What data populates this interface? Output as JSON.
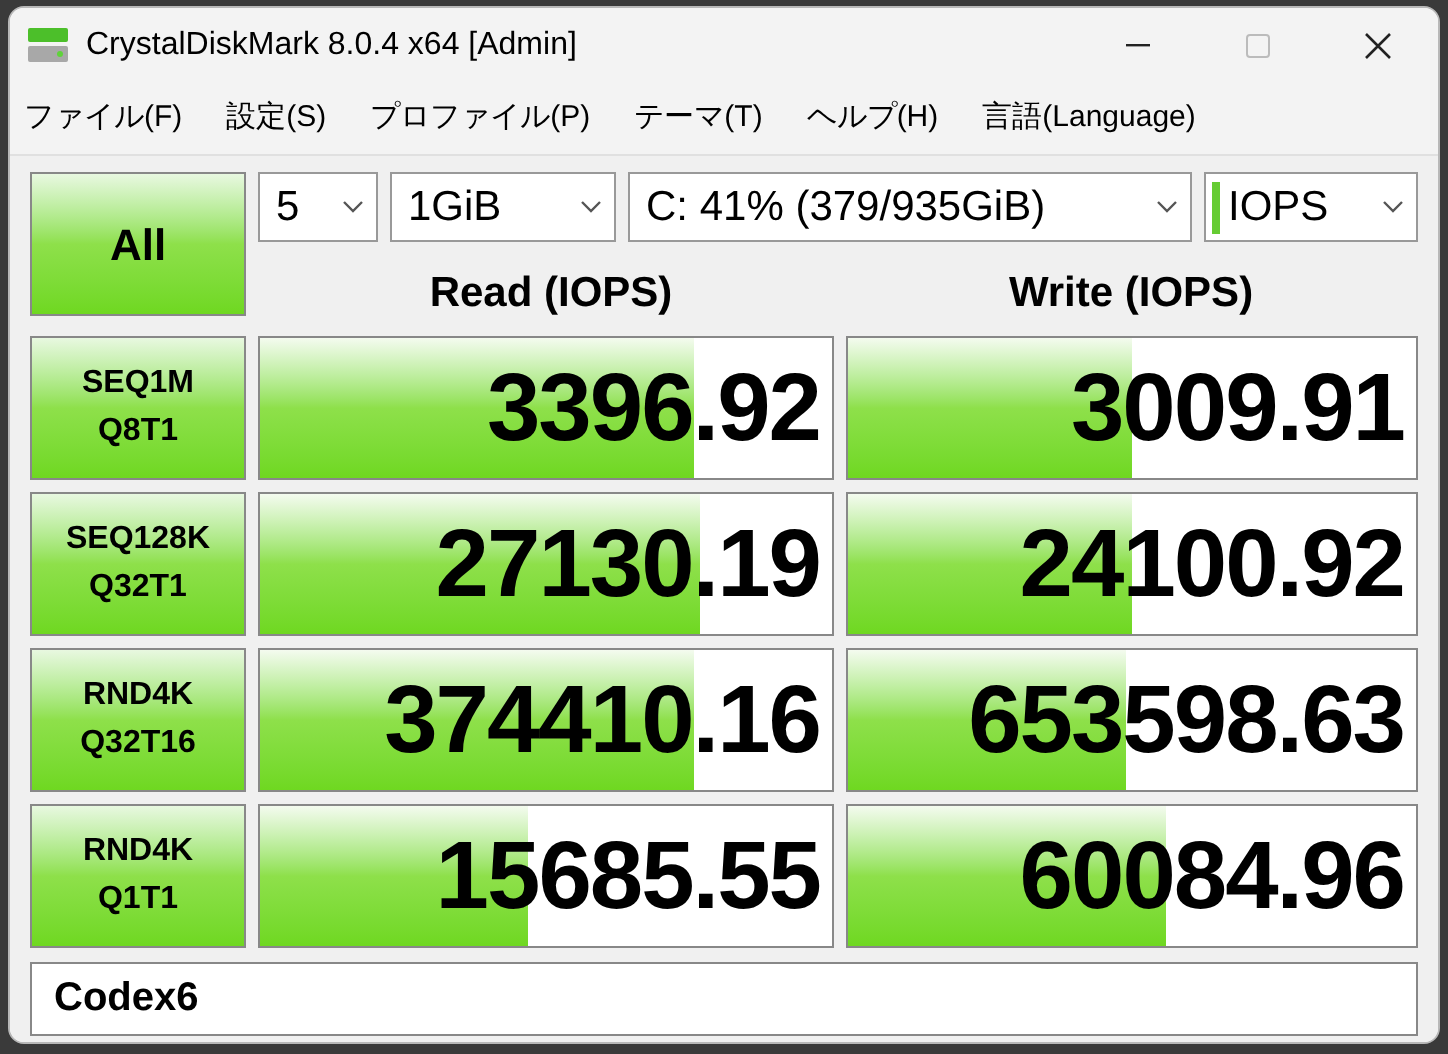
{
  "window": {
    "title": "CrystalDiskMark 8.0.4 x64 [Admin]"
  },
  "menu": [
    "ファイル(F)",
    "設定(S)",
    "プロファイル(P)",
    "テーマ(T)",
    "ヘルプ(H)",
    "言語(Language)"
  ],
  "all_button": "All",
  "selectors": [
    {
      "value": "5"
    },
    {
      "value": "1GiB"
    },
    {
      "value": "C: 41% (379/935GiB)"
    },
    {
      "value": "IOPS",
      "kind": "unit"
    }
  ],
  "headers": [
    "Read (IOPS)",
    "Write (IOPS)"
  ],
  "tests": [
    {
      "label": [
        "SEQ1M",
        "Q8T1"
      ],
      "read": {
        "value": "3396.92",
        "level": 0.76
      },
      "write": {
        "value": "3009.91",
        "level": 0.5
      }
    },
    {
      "label": [
        "SEQ128K",
        "Q32T1"
      ],
      "read": {
        "value": "27130.19",
        "level": 0.77
      },
      "write": {
        "value": "24100.92",
        "level": 0.5
      }
    },
    {
      "label": [
        "RND4K",
        "Q32T16"
      ],
      "read": {
        "value": "374410.16",
        "level": 0.76
      },
      "write": {
        "value": "653598.63",
        "level": 0.49
      }
    },
    {
      "label": [
        "RND4K",
        "Q1T1"
      ],
      "read": {
        "value": "15685.55",
        "level": 0.47
      },
      "write": {
        "value": "60084.96",
        "level": 0.56
      }
    }
  ],
  "comment": "Codex6"
}
